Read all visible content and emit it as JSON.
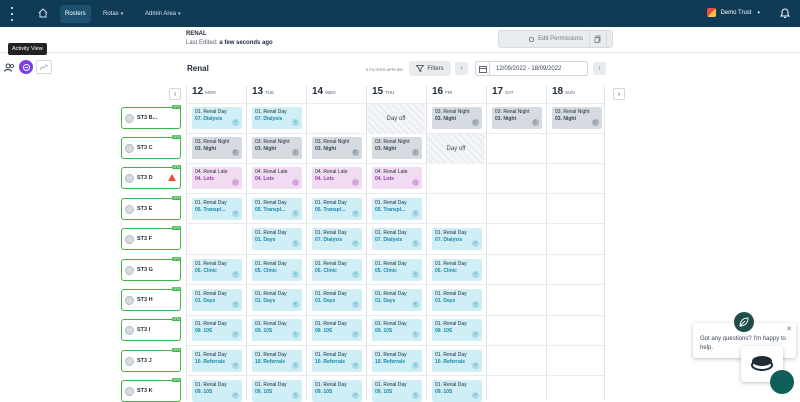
{
  "topbar": {
    "nav": [
      "Rosters",
      "Rotas",
      "Admin Area"
    ],
    "org_name": "Demo Trust"
  },
  "tooltip": "Activity View",
  "subheader": {
    "ward": "RENAL",
    "last_edited_label": "Last Edited:",
    "last_edited_value": "a few seconds ago",
    "edit_permissions": "Edit Permissions"
  },
  "toolbar": {
    "title": "Renal",
    "filters_applied": "0 FILTERS APPLIED",
    "filters_label": "Filters",
    "date_range": "12/09/2022 - 18/09/2022"
  },
  "days": [
    {
      "num": "12",
      "dow": "MON"
    },
    {
      "num": "13",
      "dow": "TUE"
    },
    {
      "num": "14",
      "dow": "WED"
    },
    {
      "num": "15",
      "dow": "THU"
    },
    {
      "num": "16",
      "dow": "FRI"
    },
    {
      "num": "17",
      "dow": "SAT"
    },
    {
      "num": "18",
      "dow": "SUN"
    }
  ],
  "staff": [
    {
      "name": "ST3 B...",
      "tag": "CPD"
    },
    {
      "name": "ST3 C",
      "tag": "CPD"
    },
    {
      "name": "ST3 D",
      "tag": "CPD"
    },
    {
      "name": "ST3 E",
      "tag": "CPD"
    },
    {
      "name": "ST3 F",
      "tag": "CPD"
    },
    {
      "name": "ST3 G",
      "tag": "CPD"
    },
    {
      "name": "ST3 H",
      "tag": "CPD"
    },
    {
      "name": "ST3 I",
      "tag": "CPD"
    },
    {
      "name": "ST3 J",
      "tag": "CPD"
    },
    {
      "name": "ST3 K",
      "tag": "CPD"
    }
  ],
  "day_off_label": "Day off",
  "chat": {
    "message": "Got any questions? I'm happy to help."
  }
}
